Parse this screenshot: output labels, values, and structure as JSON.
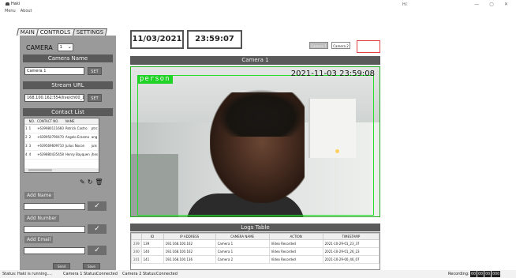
{
  "titlebar": {
    "app_name": "Haki",
    "center_badge": "Hℰ",
    "minimize": "—",
    "maximize": "▢",
    "close": "✕"
  },
  "menu": [
    "Menu",
    "About"
  ],
  "tabs": [
    "MAIN",
    "CONTROLS",
    "SETTINGS"
  ],
  "settings": {
    "camera_label": "CAMERA",
    "camera_value": "1",
    "camera_name_header": "Camera Name",
    "camera_name_value": "Camera 1",
    "set_label": "SET",
    "stream_url_header": "Stream URL",
    "stream_url_value": "168.100.162:554/live/ch00_1",
    "contact_list_header": "Contact List",
    "contacts_columns": [
      "",
      "NO.",
      "CONTACT NO.",
      "NAME",
      ""
    ],
    "contacts": [
      {
        "idx": "1",
        "no": "1",
        "contact": "+639980111660",
        "name": "Patrick Castro",
        "extra": "ptrc"
      },
      {
        "idx": "2",
        "no": "2",
        "contact": "+639950790470",
        "name": "Angelo Erasmo",
        "extra": "ang"
      },
      {
        "idx": "3",
        "no": "3",
        "contact": "+639569609710",
        "name": "Julius Nocon",
        "extra": "julx"
      },
      {
        "idx": "4",
        "no": "4",
        "contact": "+639880435458",
        "name": "Henry Bayquen",
        "extra": "jhes"
      }
    ],
    "add_name_label": "Add Name",
    "add_number_label": "Add Number",
    "add_email_label": "Add Email",
    "check_icon": "✓",
    "bottom_buttons": [
      "Send",
      "Save"
    ]
  },
  "header": {
    "date": "11/03/2021",
    "time": "23:59:07",
    "camera_buttons": [
      "Camera 1",
      "Camera 2"
    ]
  },
  "camera_view": {
    "title": "Camera 1",
    "detection_label": "person",
    "timestamp": "2021-11-03 23:59:08",
    "detection_color": "#24e02a"
  },
  "logs": {
    "title": "Logs Table",
    "columns": [
      "",
      "ID",
      "IP ADDRESS",
      "CAMERA NAME",
      "ACTION",
      "TIMESTAMP"
    ],
    "rows": [
      {
        "idx": "239",
        "id": "139",
        "ip": "192.168.100.162",
        "camera": "Camera 1",
        "action": "Video Recorded",
        "timestamp": "2021-10-29-01_23_37"
      },
      {
        "idx": "240",
        "id": "140",
        "ip": "192.168.100.162",
        "camera": "Camera 1",
        "action": "Video Recorded",
        "timestamp": "2021-10-29-01_26_23"
      },
      {
        "idx": "241",
        "id": "141",
        "ip": "192.168.100.136",
        "camera": "Camera 2",
        "action": "Video Recorded",
        "timestamp": "2021-10-29-00_46_07"
      }
    ]
  },
  "status": {
    "status_label": "Status:",
    "status_value": "Haki is running....",
    "cam1_label": "Camera 1 Status:",
    "cam1_value": "Connected",
    "cam2_label": "Camera 2 Status:",
    "cam2_value": "Connected",
    "recording_label": "Recording:",
    "timer": [
      "00",
      "00",
      "00",
      "000"
    ]
  }
}
